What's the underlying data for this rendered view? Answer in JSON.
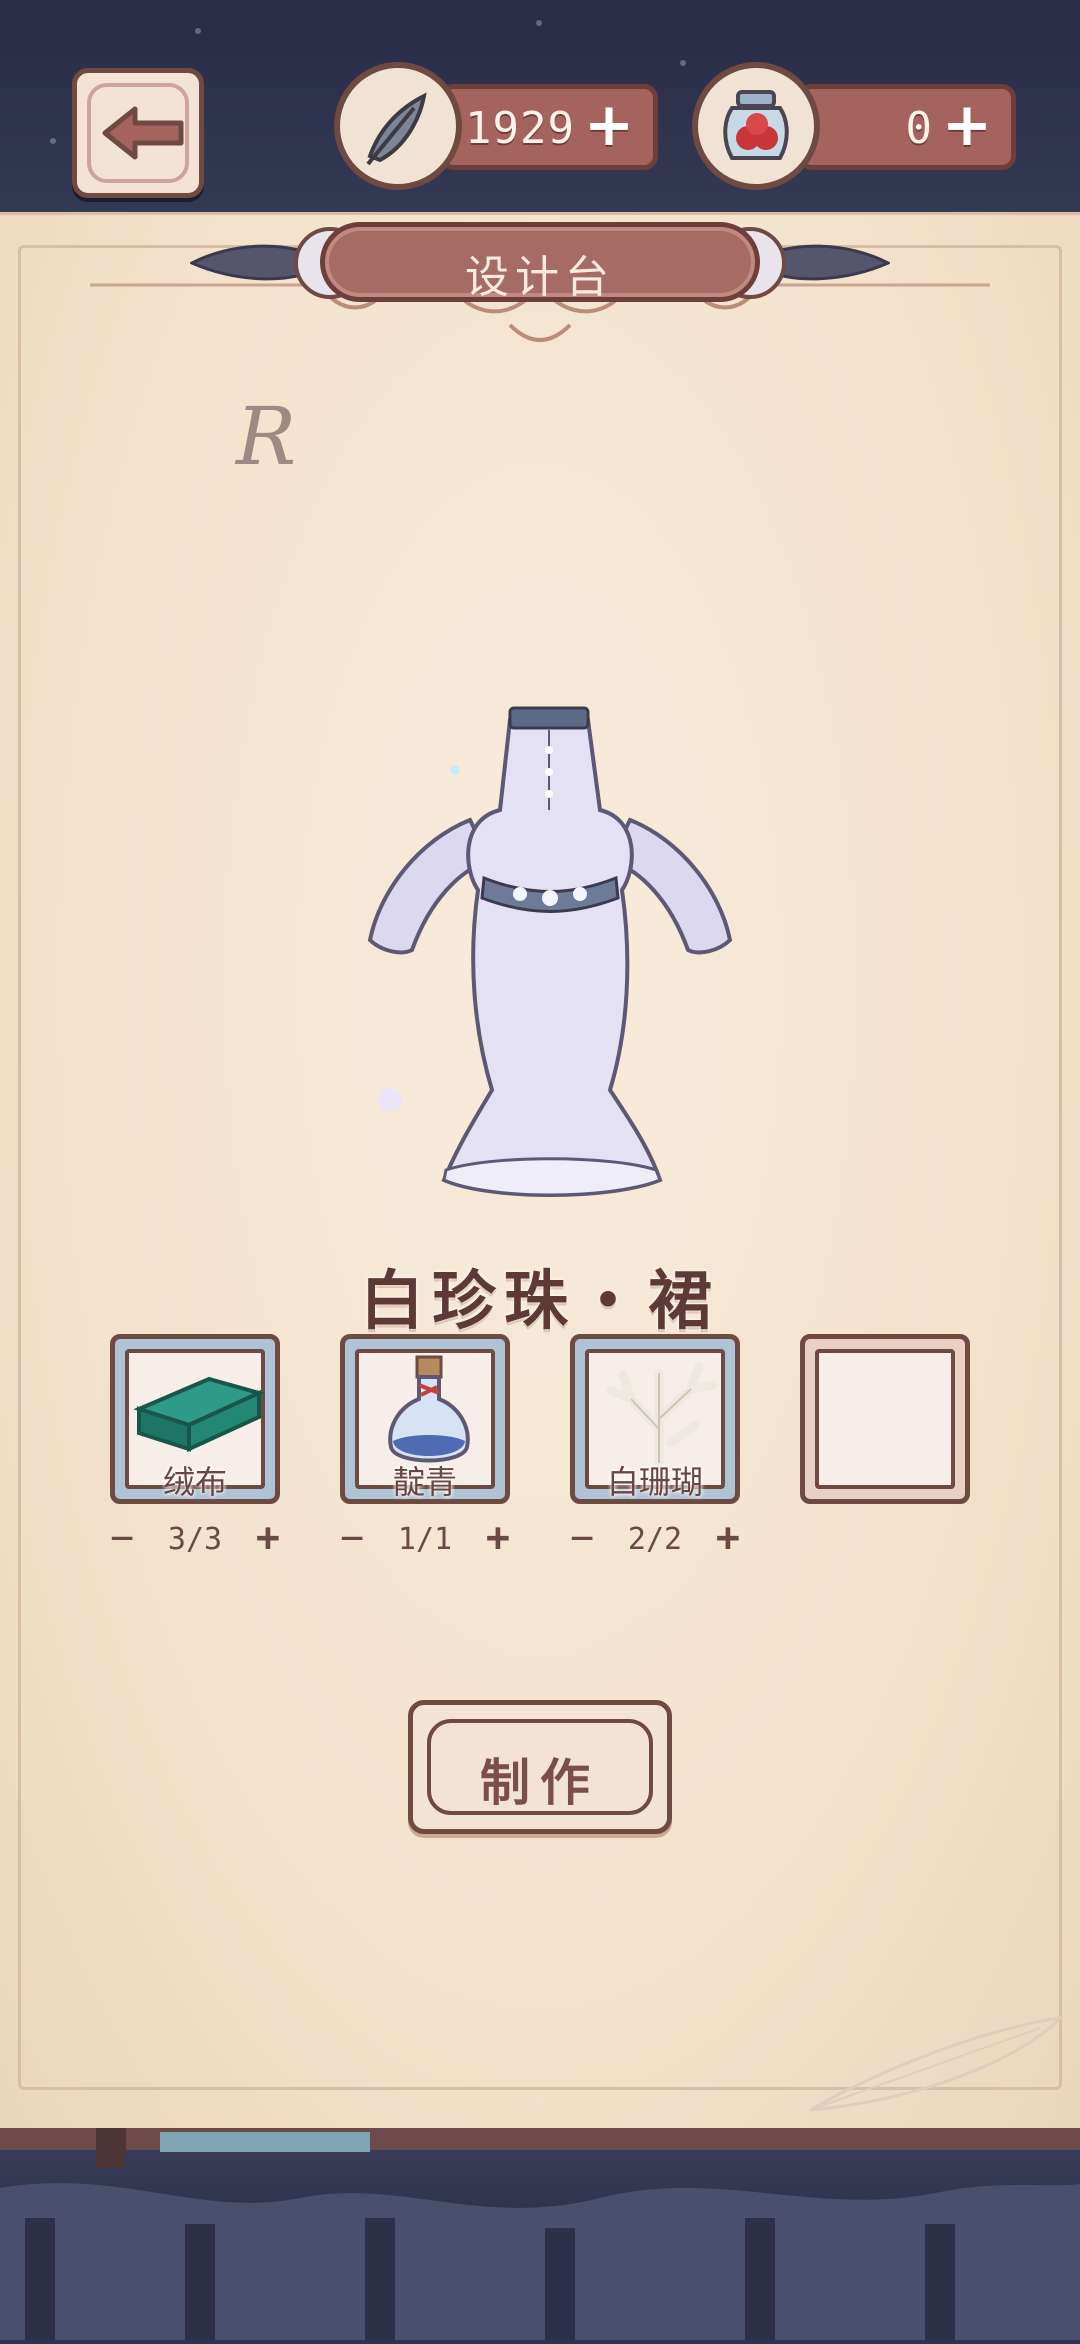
{
  "resources": [
    {
      "icon": "feather-icon",
      "value": "1929",
      "add": "+"
    },
    {
      "icon": "berry-jar-icon",
      "value": "0",
      "add": "+"
    }
  ],
  "panel": {
    "title": "设计台",
    "rank": "R"
  },
  "item": {
    "name": "白珍珠・裙"
  },
  "materials": [
    {
      "name": "绒布",
      "icon": "velvet-cloth-icon",
      "quantity": "3/3",
      "minus": "−",
      "plus": "+"
    },
    {
      "name": "靛青",
      "icon": "indigo-bottle-icon",
      "quantity": "1/1",
      "minus": "−",
      "plus": "+"
    },
    {
      "name": "白珊瑚",
      "icon": "white-coral-icon",
      "quantity": "2/2",
      "minus": "−",
      "plus": "+"
    }
  ],
  "actions": {
    "craft": "制作"
  }
}
